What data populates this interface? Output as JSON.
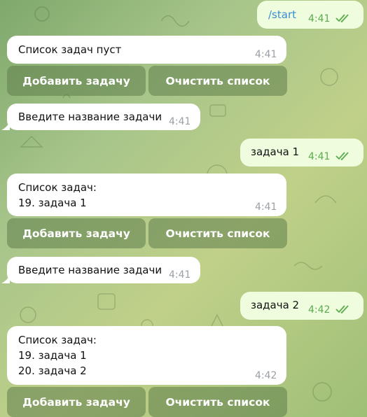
{
  "colors": {
    "incoming_bubble": "#ffffff",
    "outgoing_bubble": "#effdde",
    "outgoing_time": "#5aad4e",
    "command_link": "#3a8dd0",
    "keyboard_button": "#6b8a55"
  },
  "messages": [
    {
      "dir": "out",
      "text": "/start",
      "time": "4:41",
      "icons": [
        "double-check-icon"
      ]
    },
    {
      "dir": "in",
      "text": "Список задач пуст",
      "time": "4:41"
    },
    {
      "dir": "in",
      "text": "Введите название задачи",
      "time": "4:41"
    },
    {
      "dir": "out",
      "text": "задача 1",
      "time": "4:41",
      "icons": [
        "double-check-icon"
      ]
    },
    {
      "dir": "in",
      "lines": [
        "Список задач:",
        "19. задача 1"
      ],
      "time": "4:41"
    },
    {
      "dir": "in",
      "text": "Введите название задачи",
      "time": "4:41"
    },
    {
      "dir": "out",
      "text": "задача 2",
      "time": "4:42",
      "icons": [
        "double-check-icon"
      ]
    },
    {
      "dir": "in",
      "lines": [
        "Список задач:",
        "19. задача 1",
        "20. задача 2"
      ],
      "time": "4:42"
    }
  ],
  "keyboard": {
    "add_label": "Добавить задачу",
    "clear_label": "Очистить список"
  }
}
